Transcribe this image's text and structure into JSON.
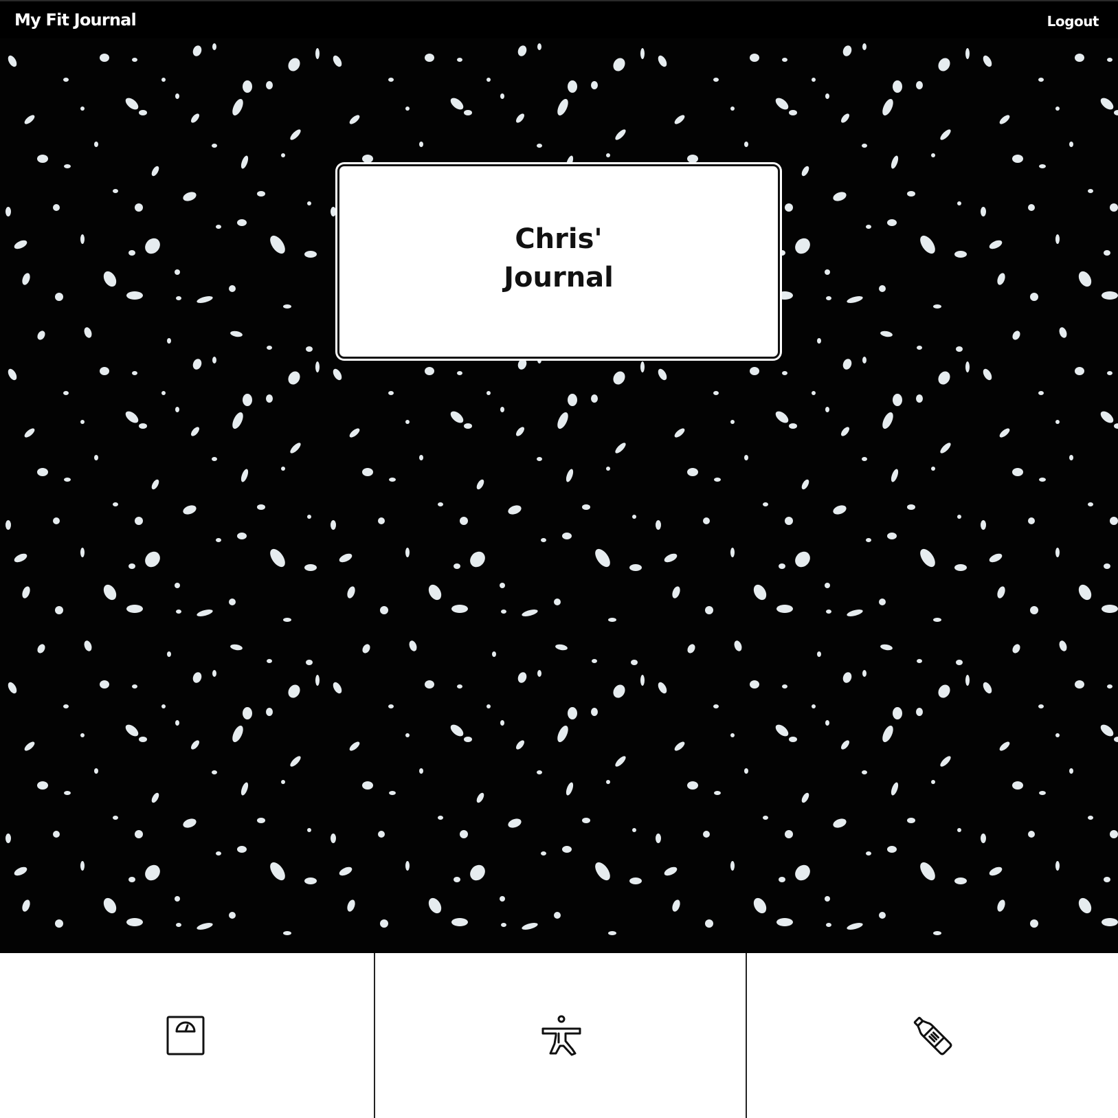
{
  "navbar": {
    "brand": "My Fit Journal",
    "logout_label": "Logout"
  },
  "cover": {
    "title_line1": "Chris'",
    "title_line2": "Journal"
  },
  "tabs": [
    {
      "icon": "scale-icon"
    },
    {
      "icon": "exercise-pose-icon"
    },
    {
      "icon": "water-bottle-icon"
    }
  ],
  "colors": {
    "navbar_bg": "#000000",
    "cover_bg": "#030303",
    "speckle": "#e6ecef",
    "card_bg": "#ffffff",
    "tabbar_bg": "#ffffff"
  }
}
